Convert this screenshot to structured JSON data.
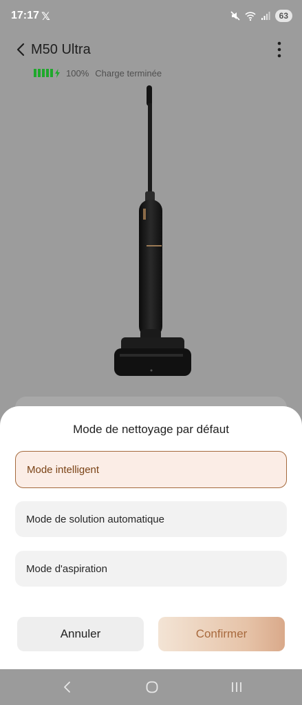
{
  "status_bar": {
    "time": "17:17",
    "notification": "𝕏",
    "battery": "63",
    "icons": [
      "mute-icon",
      "wifi-icon",
      "signal-icon"
    ]
  },
  "header": {
    "title": "M50 Ultra",
    "back_icon": "chevron-left-icon",
    "more_icon": "more-vertical-icon"
  },
  "device_status": {
    "battery_percent": "100%",
    "charge_status": "Charge terminée",
    "battery_level": 1.0,
    "battery_color": "#1fa82c"
  },
  "sheet": {
    "title": "Mode de nettoyage par défaut",
    "options": [
      {
        "label": "Mode intelligent",
        "selected": true
      },
      {
        "label": "Mode de solution automatique",
        "selected": false
      },
      {
        "label": "Mode d'aspiration",
        "selected": false
      }
    ],
    "cancel_label": "Annuler",
    "confirm_label": "Confirmer",
    "accent_color": "#a3683b"
  },
  "nav_bar": {
    "icons": [
      "back-icon",
      "home-icon",
      "recent-apps-icon"
    ]
  }
}
